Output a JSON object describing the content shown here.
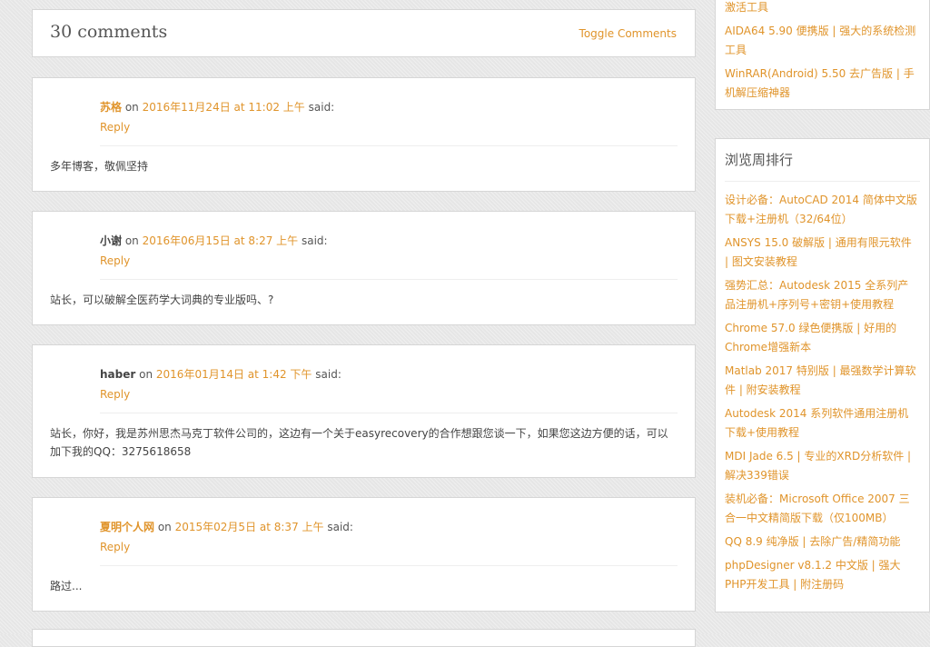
{
  "comments_section": {
    "count_label": "30 comments",
    "toggle_label": "Toggle Comments"
  },
  "comments": [
    {
      "author": "苏格",
      "author_linked": true,
      "on": "on",
      "date": "2016年11月24日 at 11:02 上午",
      "said": "said:",
      "reply": "Reply",
      "body": "多年博客，敬佩坚持"
    },
    {
      "author": "小谢",
      "author_linked": false,
      "on": "on",
      "date": "2016年06月15日 at 8:27 上午",
      "said": "said:",
      "reply": "Reply",
      "body": "站长，可以破解全医药学大词典的专业版吗、?"
    },
    {
      "author": "haber",
      "author_linked": false,
      "on": "on",
      "date": "2016年01月14日 at 1:42 下午",
      "said": "said:",
      "reply": "Reply",
      "body": "站长，你好，我是苏州思杰马克丁软件公司的，这边有一个关于easyrecovery的合作想跟您谈一下，如果您这边方便的话，可以加下我的QQ：3275618658"
    },
    {
      "author": "夏明个人网",
      "author_linked": true,
      "on": "on",
      "date": "2015年02月5日 at 8:37 上午",
      "said": "said:",
      "reply": "Reply",
      "body": "路过..."
    }
  ],
  "sidebar_top": {
    "items": [
      "激活工具",
      "AIDA64 5.90 便携版 | 强大的系统检测工具",
      "WinRAR(Android) 5.50 去广告版 | 手机解压缩神器"
    ]
  },
  "sidebar_rank": {
    "title": "浏览周排行",
    "items": [
      "设计必备：AutoCAD 2014 简体中文版下载+注册机（32/64位）",
      "ANSYS 15.0 破解版 | 通用有限元软件 | 图文安装教程",
      "强势汇总：Autodesk 2015 全系列产品注册机+序列号+密钥+使用教程",
      "Chrome 57.0 绿色便携版 | 好用的Chrome增强新本",
      "Matlab 2017 特别版 | 最强数学计算软件 | 附安装教程",
      "Autodesk 2014 系列软件通用注册机下载+使用教程",
      "MDI Jade 6.5 | 专业的XRD分析软件 | 解决339错误",
      "装机必备：Microsoft Office 2007 三合一中文精简版下载（仅100MB）",
      "QQ 8.9 纯净版 | 去除广告/精简功能",
      "phpDesigner v8.1.2 中文版 | 强大PHP开发工具 | 附注册码"
    ]
  },
  "colors": {
    "link": "#e0942b",
    "text": "#444444",
    "background": "#e6e6e6"
  }
}
